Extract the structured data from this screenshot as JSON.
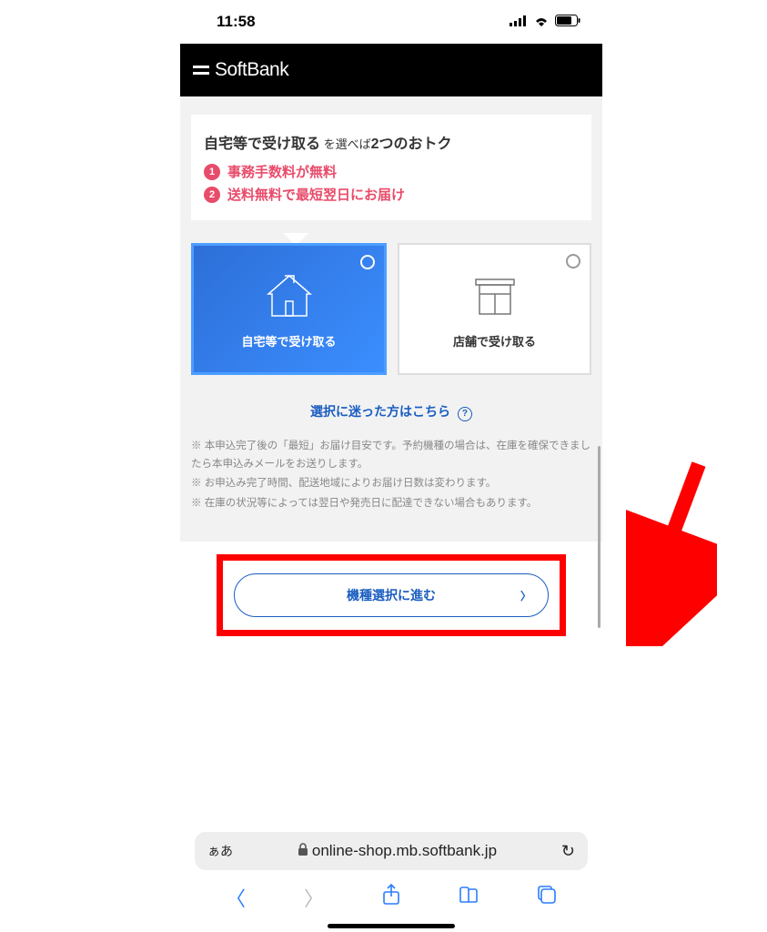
{
  "status": {
    "time": "11:58"
  },
  "header": {
    "brand": "SoftBank"
  },
  "promo": {
    "title_main": "自宅等で受け取る",
    "title_mid": " を選べば",
    "title_tail": "2つのおトク",
    "benefits": [
      {
        "num": "1",
        "text": "事務手数料が無料"
      },
      {
        "num": "2",
        "text": "送料無料で最短翌日にお届け"
      }
    ]
  },
  "options": [
    {
      "label": "自宅等で受け取る",
      "selected": true
    },
    {
      "label": "店舗で受け取る",
      "selected": false
    }
  ],
  "help_link": "選択に迷った方はこちら",
  "notes": [
    "※ 本申込完了後の「最短」お届け目安です。予約機種の場合は、在庫を確保できましたら本申込みメールをお送りします。",
    "※ お申込み完了時間、配送地域によりお届け日数は変わります。",
    "※ 在庫の状況等によっては翌日や発売日に配達できない場合もあります。"
  ],
  "cta": {
    "label": "機種選択に進む"
  },
  "url_bar": {
    "aa": "ぁあ",
    "domain": "online-shop.mb.softbank.jp"
  }
}
